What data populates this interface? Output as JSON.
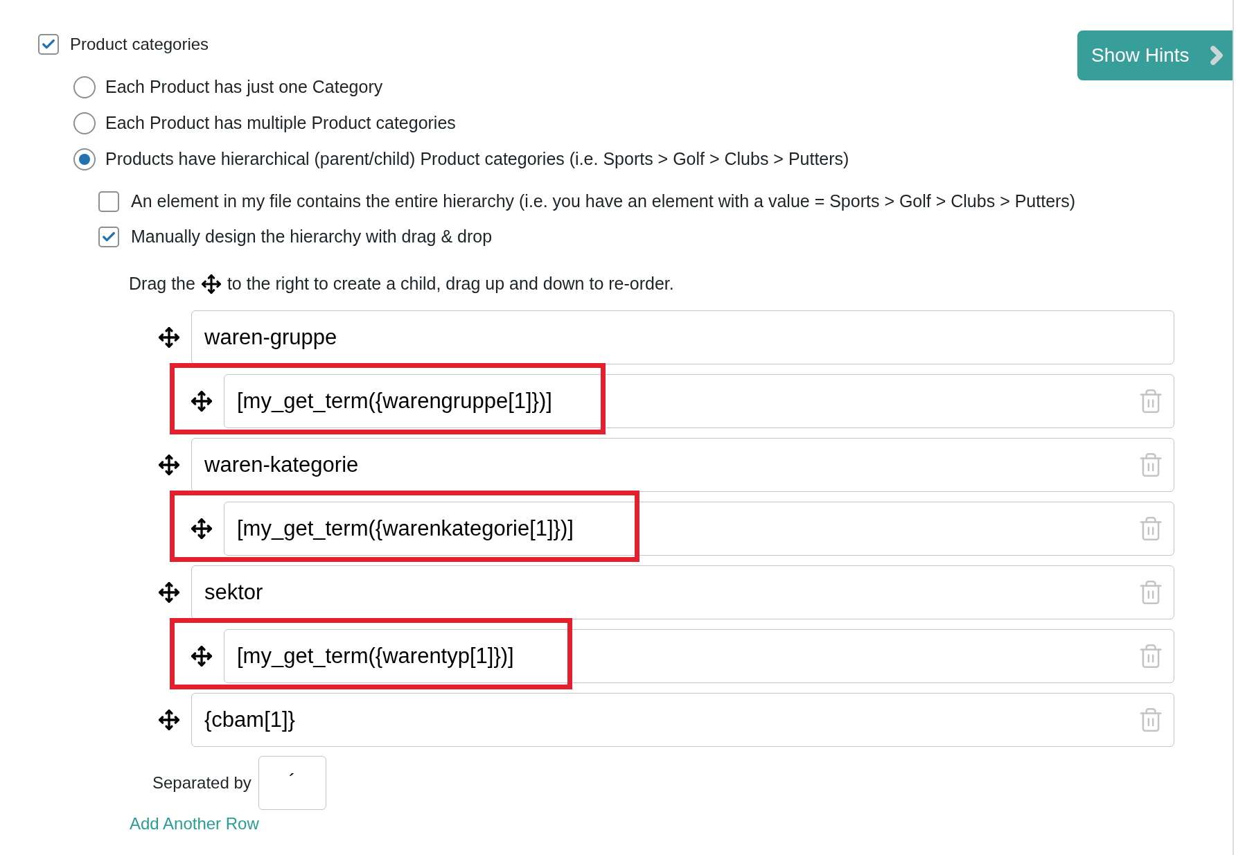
{
  "product_categories": {
    "label": "Product categories",
    "checked": true
  },
  "hints_button": {
    "label": "Show Hints"
  },
  "category_options": [
    {
      "label": "Each Product has just one Category",
      "selected": false
    },
    {
      "label": "Each Product has multiple Product categories",
      "selected": false
    },
    {
      "label": "Products have hierarchical (parent/child) Product categories (i.e. Sports > Golf > Clubs > Putters)",
      "selected": true
    }
  ],
  "hierarchy_options": [
    {
      "label": "An element in my file contains the entire hierarchy (i.e. you have an element with a value = Sports > Golf > Clubs > Putters)",
      "checked": false
    },
    {
      "label": "Manually design the hierarchy with drag & drop",
      "checked": true
    }
  ],
  "drag_hint": {
    "before": "Drag the",
    "after": "to the right to create a child, drag up and down to re-order."
  },
  "hierarchy_rows": [
    {
      "value": "waren-gruppe",
      "kind": "parent",
      "highlighted": false,
      "deletable": false
    },
    {
      "value": "[my_get_term({warengruppe[1]})]",
      "kind": "child",
      "highlighted": true,
      "deletable": true
    },
    {
      "value": "waren-kategorie",
      "kind": "parent",
      "highlighted": false,
      "deletable": true
    },
    {
      "value": "[my_get_term({warenkategorie[1]})]",
      "kind": "child",
      "highlighted": true,
      "deletable": true
    },
    {
      "value": "sektor",
      "kind": "parent",
      "highlighted": false,
      "deletable": true
    },
    {
      "value": "[my_get_term({warentyp[1]})]",
      "kind": "child",
      "highlighted": true,
      "deletable": true
    },
    {
      "value": "{cbam[1]}",
      "kind": "parent",
      "highlighted": false,
      "deletable": true
    }
  ],
  "separator": {
    "label": "Separated by",
    "value": "´"
  },
  "add_row_link": "Add Another Row"
}
